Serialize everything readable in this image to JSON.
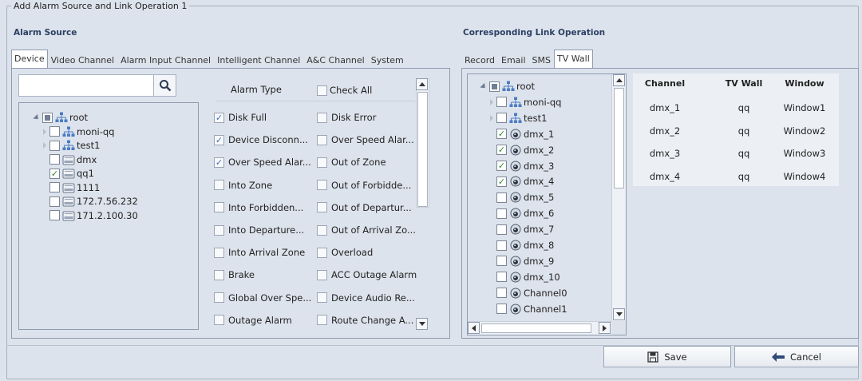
{
  "dialog": {
    "title": "Add Alarm Source and Link Operation 1"
  },
  "alarm_source": {
    "title": "Alarm Source",
    "tabs": [
      "Device",
      "Video Channel",
      "Alarm Input Channel",
      "Intelligent Channel",
      "A&C Channel",
      "System"
    ],
    "active_tab": "Device",
    "search": {
      "value": "",
      "placeholder": ""
    },
    "tree": [
      {
        "label": "root",
        "level": 0,
        "state": "partial",
        "icon": "network-icon",
        "expanded": true
      },
      {
        "label": "moni-qq",
        "level": 1,
        "state": "unchecked",
        "icon": "network-icon",
        "expandable": true
      },
      {
        "label": "test1",
        "level": 1,
        "state": "unchecked",
        "icon": "network-icon",
        "expandable": true
      },
      {
        "label": "dmx",
        "level": 1,
        "state": "unchecked",
        "icon": "device-icon"
      },
      {
        "label": "qq1",
        "level": 1,
        "state": "checked",
        "icon": "device-icon"
      },
      {
        "label": "1111",
        "level": 1,
        "state": "unchecked",
        "icon": "device-icon"
      },
      {
        "label": "172.7.56.232",
        "level": 1,
        "state": "unchecked",
        "icon": "device-icon"
      },
      {
        "label": "171.2.100.30",
        "level": 1,
        "state": "unchecked",
        "icon": "device-icon"
      }
    ],
    "alarm_type_header": "Alarm Type",
    "check_all_label": "Check All",
    "alarm_types": [
      [
        "Disk Full",
        true
      ],
      [
        "Disk Error",
        false
      ],
      [
        "Device Disconn...",
        true
      ],
      [
        "Over Speed Alar...",
        false
      ],
      [
        "Over Speed Alar...",
        true
      ],
      [
        "Out of Zone",
        false
      ],
      [
        "Into Zone",
        false
      ],
      [
        "Out of Forbidde...",
        false
      ],
      [
        "Into Forbidden...",
        false
      ],
      [
        "Out of Departur...",
        false
      ],
      [
        "Into Departure...",
        false
      ],
      [
        "Out of Arrival Zo...",
        false
      ],
      [
        "Into Arrival Zone",
        false
      ],
      [
        "Overload",
        false
      ],
      [
        "Brake",
        false
      ],
      [
        "ACC Outage Alarm",
        false
      ],
      [
        "Global Over Spe...",
        false
      ],
      [
        "Device Audio Re...",
        false
      ],
      [
        "Outage Alarm",
        false
      ],
      [
        "Route Change A...",
        false
      ]
    ]
  },
  "link_operation": {
    "title": "Corresponding Link Operation",
    "tabs": [
      "Record",
      "Email",
      "SMS",
      "TV Wall"
    ],
    "active_tab": "TV Wall",
    "tree": [
      {
        "label": "root",
        "level": 0,
        "state": "partial",
        "icon": "network-icon",
        "expanded": true
      },
      {
        "label": "moni-qq",
        "level": 1,
        "state": "unchecked",
        "icon": "network-icon",
        "expandable": true
      },
      {
        "label": "test1",
        "level": 1,
        "state": "unchecked",
        "icon": "network-icon",
        "expandable": true
      },
      {
        "label": "dmx_1",
        "level": 1,
        "state": "checked",
        "icon": "camera-icon"
      },
      {
        "label": "dmx_2",
        "level": 1,
        "state": "checked",
        "icon": "camera-icon"
      },
      {
        "label": "dmx_3",
        "level": 1,
        "state": "checked",
        "icon": "camera-icon"
      },
      {
        "label": "dmx_4",
        "level": 1,
        "state": "checked",
        "icon": "camera-icon"
      },
      {
        "label": "dmx_5",
        "level": 1,
        "state": "unchecked",
        "icon": "camera-icon"
      },
      {
        "label": "dmx_6",
        "level": 1,
        "state": "unchecked",
        "icon": "camera-icon"
      },
      {
        "label": "dmx_7",
        "level": 1,
        "state": "unchecked",
        "icon": "camera-icon"
      },
      {
        "label": "dmx_8",
        "level": 1,
        "state": "unchecked",
        "icon": "camera-icon"
      },
      {
        "label": "dmx_9",
        "level": 1,
        "state": "unchecked",
        "icon": "camera-icon"
      },
      {
        "label": "dmx_10",
        "level": 1,
        "state": "unchecked",
        "icon": "camera-icon"
      },
      {
        "label": "Channel0",
        "level": 1,
        "state": "unchecked",
        "icon": "camera-icon"
      },
      {
        "label": "Channel1",
        "level": 1,
        "state": "unchecked",
        "icon": "camera-icon"
      }
    ],
    "tv_table": {
      "headers": [
        "Channel",
        "TV Wall",
        "Window"
      ],
      "rows": [
        [
          "dmx_1",
          "qq",
          "Window1"
        ],
        [
          "dmx_2",
          "qq",
          "Window2"
        ],
        [
          "dmx_3",
          "qq",
          "Window3"
        ],
        [
          "dmx_4",
          "qq",
          "Window4"
        ]
      ]
    }
  },
  "buttons": {
    "save": "Save",
    "cancel": "Cancel"
  },
  "colors": {
    "background": "#dde3ec",
    "section_title": "#2a3f63",
    "check_green": "#2a8a2a",
    "check_blue": "#3a6ec2"
  }
}
